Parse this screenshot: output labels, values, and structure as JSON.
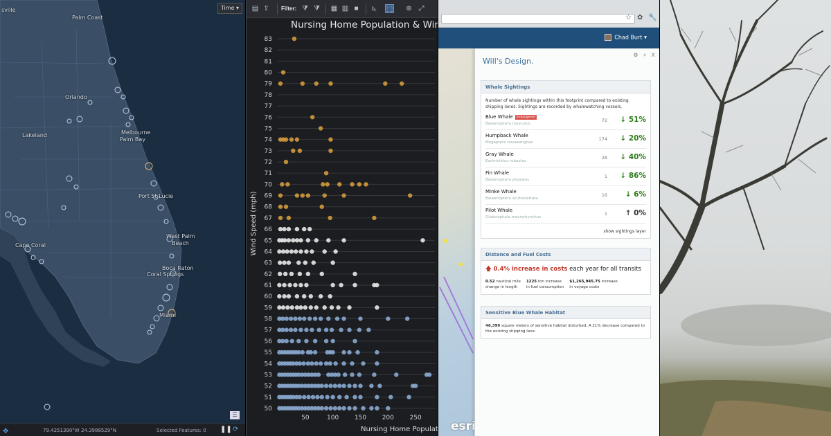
{
  "map": {
    "time_button": "Time",
    "labels": {
      "sville": "sville",
      "palm_coast": "Palm Coast",
      "orlando": "Orlando",
      "melbourne": "Melbourne",
      "palm_bay": "Palm Bay",
      "lakeland": "Lakeland",
      "port_st_lucie": "Port St Lucie",
      "west_palm_beach_1": "West Palm",
      "west_palm_beach_2": "Beach",
      "cape_coral": "Cape Coral",
      "boca_raton": "Boca Raton",
      "coral_springs": "Coral Springs",
      "miami": "Miami"
    },
    "status": {
      "coords": "79.4251390°W 24.3988529°N",
      "selected_features": "Selected Features: 0"
    }
  },
  "chart_toolbar": {
    "filter_label": "Filter:"
  },
  "chart_data": {
    "type": "scatter",
    "title": "Nursing Home Population & Win",
    "xlabel": "Nursing Home Populat",
    "ylabel": "Wind Speed (mph)",
    "xlim": [
      0,
      285
    ],
    "ylim": [
      50,
      83
    ],
    "xticks": [
      50,
      100,
      150,
      200,
      250
    ],
    "yticks": [
      50,
      51,
      52,
      53,
      54,
      55,
      56,
      57,
      58,
      59,
      60,
      61,
      62,
      63,
      64,
      65,
      66,
      67,
      68,
      69,
      70,
      71,
      72,
      73,
      74,
      75,
      76,
      77,
      78,
      79,
      80,
      81,
      82,
      83
    ],
    "grid": true,
    "legend": false,
    "points": [
      [
        30,
        83
      ],
      [
        10,
        80
      ],
      [
        5,
        79
      ],
      [
        45,
        79
      ],
      [
        70,
        79
      ],
      [
        96,
        79
      ],
      [
        195,
        79
      ],
      [
        225,
        79
      ],
      [
        63,
        76
      ],
      [
        78,
        75
      ],
      [
        5,
        74
      ],
      [
        10,
        74
      ],
      [
        15,
        74
      ],
      [
        25,
        74
      ],
      [
        35,
        74
      ],
      [
        96,
        74
      ],
      [
        28,
        73
      ],
      [
        40,
        73
      ],
      [
        96,
        73
      ],
      [
        15,
        72
      ],
      [
        88,
        71
      ],
      [
        8,
        70
      ],
      [
        18,
        70
      ],
      [
        82,
        70
      ],
      [
        90,
        70
      ],
      [
        112,
        70
      ],
      [
        135,
        70
      ],
      [
        148,
        70
      ],
      [
        160,
        70
      ],
      [
        5,
        69
      ],
      [
        35,
        69
      ],
      [
        45,
        69
      ],
      [
        55,
        69
      ],
      [
        85,
        69
      ],
      [
        120,
        69
      ],
      [
        240,
        69
      ],
      [
        5,
        68
      ],
      [
        15,
        68
      ],
      [
        80,
        68
      ],
      [
        5,
        67
      ],
      [
        20,
        67
      ],
      [
        95,
        67
      ],
      [
        175,
        67
      ],
      [
        5,
        66
      ],
      [
        12,
        66
      ],
      [
        20,
        66
      ],
      [
        35,
        66
      ],
      [
        48,
        66
      ],
      [
        58,
        66
      ],
      [
        3,
        65
      ],
      [
        8,
        65
      ],
      [
        13,
        65
      ],
      [
        20,
        65
      ],
      [
        28,
        65
      ],
      [
        35,
        65
      ],
      [
        42,
        65
      ],
      [
        55,
        65
      ],
      [
        70,
        65
      ],
      [
        92,
        65
      ],
      [
        120,
        65
      ],
      [
        263,
        65
      ],
      [
        3,
        64
      ],
      [
        10,
        64
      ],
      [
        17,
        64
      ],
      [
        25,
        64
      ],
      [
        33,
        64
      ],
      [
        42,
        64
      ],
      [
        52,
        64
      ],
      [
        62,
        64
      ],
      [
        85,
        64
      ],
      [
        105,
        64
      ],
      [
        4,
        63
      ],
      [
        12,
        63
      ],
      [
        20,
        63
      ],
      [
        38,
        63
      ],
      [
        50,
        63
      ],
      [
        65,
        63
      ],
      [
        100,
        63
      ],
      [
        4,
        62
      ],
      [
        14,
        62
      ],
      [
        25,
        62
      ],
      [
        40,
        62
      ],
      [
        55,
        62
      ],
      [
        80,
        62
      ],
      [
        140,
        62
      ],
      [
        3,
        61
      ],
      [
        12,
        61
      ],
      [
        22,
        61
      ],
      [
        32,
        61
      ],
      [
        42,
        61
      ],
      [
        52,
        61
      ],
      [
        100,
        61
      ],
      [
        115,
        61
      ],
      [
        140,
        61
      ],
      [
        175,
        61
      ],
      [
        180,
        61
      ],
      [
        3,
        60
      ],
      [
        12,
        60
      ],
      [
        20,
        60
      ],
      [
        35,
        60
      ],
      [
        48,
        60
      ],
      [
        60,
        60
      ],
      [
        78,
        60
      ],
      [
        95,
        60
      ],
      [
        3,
        59
      ],
      [
        10,
        59
      ],
      [
        18,
        59
      ],
      [
        26,
        59
      ],
      [
        35,
        59
      ],
      [
        42,
        59
      ],
      [
        50,
        59
      ],
      [
        60,
        59
      ],
      [
        70,
        59
      ],
      [
        85,
        59
      ],
      [
        98,
        59
      ],
      [
        110,
        59
      ],
      [
        130,
        59
      ],
      [
        180,
        59
      ],
      [
        3,
        58
      ],
      [
        9,
        58
      ],
      [
        16,
        58
      ],
      [
        24,
        58
      ],
      [
        32,
        58
      ],
      [
        40,
        58
      ],
      [
        48,
        58
      ],
      [
        58,
        58
      ],
      [
        68,
        58
      ],
      [
        78,
        58
      ],
      [
        92,
        58
      ],
      [
        108,
        58
      ],
      [
        120,
        58
      ],
      [
        150,
        58
      ],
      [
        200,
        58
      ],
      [
        235,
        58
      ],
      [
        3,
        57
      ],
      [
        9,
        57
      ],
      [
        16,
        57
      ],
      [
        24,
        57
      ],
      [
        32,
        57
      ],
      [
        42,
        57
      ],
      [
        52,
        57
      ],
      [
        62,
        57
      ],
      [
        75,
        57
      ],
      [
        88,
        57
      ],
      [
        98,
        57
      ],
      [
        115,
        57
      ],
      [
        130,
        57
      ],
      [
        148,
        57
      ],
      [
        165,
        57
      ],
      [
        3,
        56
      ],
      [
        9,
        56
      ],
      [
        16,
        56
      ],
      [
        26,
        56
      ],
      [
        38,
        56
      ],
      [
        52,
        56
      ],
      [
        68,
        56
      ],
      [
        88,
        56
      ],
      [
        100,
        56
      ],
      [
        140,
        56
      ],
      [
        3,
        55
      ],
      [
        8,
        55
      ],
      [
        13,
        55
      ],
      [
        18,
        55
      ],
      [
        23,
        55
      ],
      [
        28,
        55
      ],
      [
        33,
        55
      ],
      [
        38,
        55
      ],
      [
        45,
        55
      ],
      [
        55,
        55
      ],
      [
        60,
        55
      ],
      [
        68,
        55
      ],
      [
        90,
        55
      ],
      [
        95,
        55
      ],
      [
        100,
        55
      ],
      [
        120,
        55
      ],
      [
        130,
        55
      ],
      [
        145,
        55
      ],
      [
        180,
        55
      ],
      [
        3,
        54
      ],
      [
        8,
        54
      ],
      [
        13,
        54
      ],
      [
        18,
        54
      ],
      [
        23,
        54
      ],
      [
        28,
        54
      ],
      [
        34,
        54
      ],
      [
        40,
        54
      ],
      [
        47,
        54
      ],
      [
        55,
        54
      ],
      [
        62,
        54
      ],
      [
        70,
        54
      ],
      [
        78,
        54
      ],
      [
        88,
        54
      ],
      [
        95,
        54
      ],
      [
        105,
        54
      ],
      [
        120,
        54
      ],
      [
        135,
        54
      ],
      [
        155,
        54
      ],
      [
        180,
        54
      ],
      [
        3,
        53
      ],
      [
        8,
        53
      ],
      [
        13,
        53
      ],
      [
        18,
        53
      ],
      [
        23,
        53
      ],
      [
        28,
        53
      ],
      [
        33,
        53
      ],
      [
        38,
        53
      ],
      [
        44,
        53
      ],
      [
        50,
        53
      ],
      [
        56,
        53
      ],
      [
        62,
        53
      ],
      [
        68,
        53
      ],
      [
        74,
        53
      ],
      [
        92,
        53
      ],
      [
        98,
        53
      ],
      [
        104,
        53
      ],
      [
        110,
        53
      ],
      [
        122,
        53
      ],
      [
        135,
        53
      ],
      [
        148,
        53
      ],
      [
        175,
        53
      ],
      [
        215,
        53
      ],
      [
        270,
        53
      ],
      [
        275,
        53
      ],
      [
        3,
        52
      ],
      [
        8,
        52
      ],
      [
        13,
        52
      ],
      [
        18,
        52
      ],
      [
        23,
        52
      ],
      [
        28,
        52
      ],
      [
        33,
        52
      ],
      [
        38,
        52
      ],
      [
        44,
        52
      ],
      [
        50,
        52
      ],
      [
        56,
        52
      ],
      [
        62,
        52
      ],
      [
        68,
        52
      ],
      [
        74,
        52
      ],
      [
        80,
        52
      ],
      [
        88,
        52
      ],
      [
        96,
        52
      ],
      [
        104,
        52
      ],
      [
        112,
        52
      ],
      [
        120,
        52
      ],
      [
        130,
        52
      ],
      [
        140,
        52
      ],
      [
        150,
        52
      ],
      [
        170,
        52
      ],
      [
        185,
        52
      ],
      [
        245,
        52
      ],
      [
        250,
        52
      ],
      [
        3,
        51
      ],
      [
        8,
        51
      ],
      [
        13,
        51
      ],
      [
        18,
        51
      ],
      [
        23,
        51
      ],
      [
        28,
        51
      ],
      [
        34,
        51
      ],
      [
        40,
        51
      ],
      [
        48,
        51
      ],
      [
        56,
        51
      ],
      [
        64,
        51
      ],
      [
        72,
        51
      ],
      [
        80,
        51
      ],
      [
        90,
        51
      ],
      [
        100,
        51
      ],
      [
        112,
        51
      ],
      [
        125,
        51
      ],
      [
        140,
        51
      ],
      [
        150,
        51
      ],
      [
        180,
        51
      ],
      [
        205,
        51
      ],
      [
        238,
        51
      ],
      [
        3,
        50
      ],
      [
        8,
        50
      ],
      [
        13,
        50
      ],
      [
        18,
        50
      ],
      [
        23,
        50
      ],
      [
        28,
        50
      ],
      [
        33,
        50
      ],
      [
        38,
        50
      ],
      [
        44,
        50
      ],
      [
        50,
        50
      ],
      [
        56,
        50
      ],
      [
        62,
        50
      ],
      [
        68,
        50
      ],
      [
        74,
        50
      ],
      [
        80,
        50
      ],
      [
        88,
        50
      ],
      [
        96,
        50
      ],
      [
        104,
        50
      ],
      [
        112,
        50
      ],
      [
        120,
        50
      ],
      [
        130,
        50
      ],
      [
        140,
        50
      ],
      [
        155,
        50
      ],
      [
        170,
        50
      ],
      [
        180,
        50
      ],
      [
        200,
        50
      ]
    ]
  },
  "browser": {
    "user_name": "Chad Burt"
  },
  "panel": {
    "title": "Will's Design.",
    "tools": [
      "⚙",
      "+",
      "X"
    ],
    "whale_card": {
      "heading": "Whale Sightings",
      "description": "Number of whale sightings within this footprint compared to existing shipping lanes. Sightings are recorded by whalewatching vessels.",
      "rows": [
        {
          "name": "Blue Whale",
          "badge": "Endangered",
          "sci": "Balaenoptera musculus",
          "count": "72",
          "pct": "51%",
          "dir": "↓"
        },
        {
          "name": "Humpback Whale",
          "badge": "",
          "sci": "Megaptera novaeangliae",
          "count": "174",
          "pct": "20%",
          "dir": "↓"
        },
        {
          "name": "Gray Whale",
          "badge": "",
          "sci": "Eschrichtius robustus",
          "count": "28",
          "pct": "40%",
          "dir": "↓"
        },
        {
          "name": "Fin Whale",
          "badge": "",
          "sci": "Balaenoptera physalus",
          "count": "1",
          "pct": "86%",
          "dir": "↓"
        },
        {
          "name": "Minke Whale",
          "badge": "",
          "sci": "Balaenoptera acutorostrata",
          "count": "16",
          "pct": "6%",
          "dir": "↓"
        },
        {
          "name": "Pilot Whale",
          "badge": "",
          "sci": "Globicephala macrorhynchus",
          "count": "1",
          "pct": "0%",
          "dir": "↑"
        }
      ],
      "show_layer": "show sightings layer"
    },
    "cost_card": {
      "heading": "Distance and Fuel Costs",
      "increase": "0.4% increase in costs",
      "rest": " each year for all transits",
      "stats": [
        {
          "value": "0.52",
          "label1": " nautical mile",
          "label2": "change in length"
        },
        {
          "value": "1225",
          "label1": " ton increase",
          "label2": "in fuel consumption"
        },
        {
          "value": "$1,265,945.75",
          "label1": " increase",
          "label2": "in voyage costs"
        }
      ]
    },
    "habitat_card": {
      "heading": "Sensitive Blue Whale Habitat",
      "value": "48,399",
      "text": " square meters of sensitive habitat disturbed. A 21% decrease compared to the existing shipping lane."
    }
  },
  "esri_logo": "esri",
  "colors": {
    "point_orange": "#d19a3c",
    "point_white": "#e8e8e8",
    "point_blue": "#8aaad0",
    "green_change": "#2e7d1d",
    "header_blue": "#1f4f7a"
  }
}
